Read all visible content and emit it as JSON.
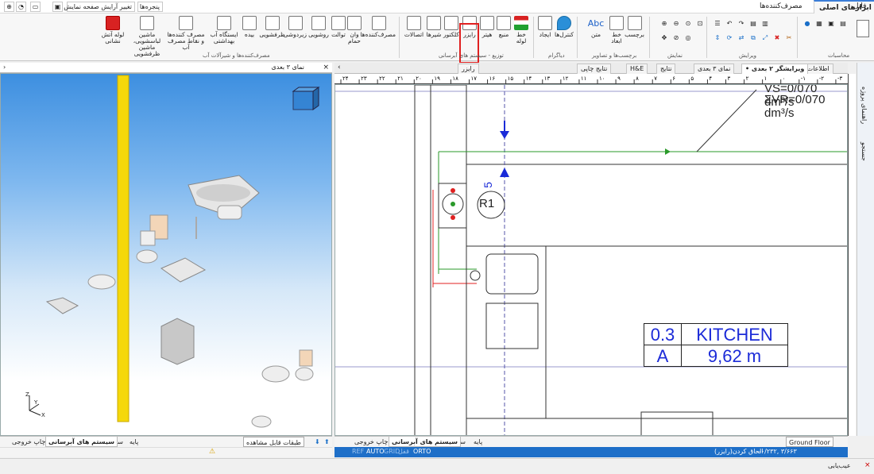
{
  "menubar": {
    "tabs": [
      "فایل",
      "ابزارهای اصلی",
      "مصرف‌کننده‌ها"
    ],
    "windows": "پنجره‌ها",
    "change_layout": "تغییر آرایش صفحه نمایش"
  },
  "ribbon": {
    "buttons": [
      "لوله آتش نشانی",
      "ماشین لباسشویی، ماشین ظرفشویی",
      "مصرف کننده‌ها و نقاط مصرف آب",
      "ایستگاه آب بهداشتی",
      "بیده",
      "ظرفشویی",
      "زیردوشی",
      "روشویی",
      "توالت",
      "وان حمام",
      "مصرف‌کننده‌ها",
      "اتصالات",
      "شیرها",
      "کلکتور",
      "رایزر",
      "هیتر",
      "منبع",
      "خط لوله",
      "کنترل‌ها",
      "ایجاد",
      "متن",
      "خط ابعاد",
      "برچسب"
    ],
    "groups": [
      "مصرف‌کننده‌ها و شیرآلات آب",
      "توزیع - سیستم های آبرسانی",
      "دیاگرام",
      "برچسب‌ها و تصاویر",
      "نمایش",
      "ویرایش",
      "محاسبات"
    ],
    "abc": "Abc"
  },
  "left_view": {
    "title": "نمای ۳ بعدی",
    "axes": [
      "Z",
      "Y",
      "X"
    ]
  },
  "doc_tabs": [
    "اطلاعات کلی",
    "ویرایشگر ۲ بعدی •",
    "نمای ۳ بعدی",
    "نتایج",
    "H&E",
    "نتایج چاپی",
    "رایزر"
  ],
  "drawing": {
    "vs": "VS=0/070 dm³/s",
    "svr": "ΣVR=0/070 dm³/s",
    "riser": "R1",
    "num5": "5",
    "room": {
      "r1c1": "0.3",
      "r1c2": "KITCHEN",
      "r2c1": "A",
      "r2c2": "9,62 m"
    }
  },
  "ruler_labels": [
    "۲۴",
    "۲۳",
    "۲۲",
    "۲۱",
    "۲۰",
    "۱۹",
    "۱۸",
    "۱۷",
    "۱۶",
    "۱۵",
    "۱۴",
    "۱۳",
    "۱۲",
    "۱۱",
    "۱۰",
    "۹",
    "۸",
    "۷",
    "۶",
    "۵",
    "۴",
    "۳",
    "۲",
    "۱",
    "۰",
    "-۱",
    "-۲",
    "-۳"
  ],
  "bottom_left": {
    "tabs": [
      "پایه",
      "ساخت",
      "سیستم های آبرسانی",
      "چاپ خروجی"
    ],
    "layers": "طبقات قابل مشاهده"
  },
  "bottom_right": {
    "tabs": [
      "پایه",
      "ساخت",
      "سیستم های آبرسانی",
      "چاپ خروجی"
    ],
    "floor": "Ground Floor"
  },
  "status": {
    "modes": [
      "REF",
      "AUTO",
      "GRID",
      "ORTO"
    ],
    "hint": "الحاق کردن(رایزر)",
    "coords": "-۰/۲۳۲, ۳/۶۶۳",
    "mode_extra": "قفل"
  },
  "side": {
    "tabs": [
      "راهنمای پروژه",
      "جستجو"
    ]
  },
  "footer": {
    "label": "عیب‌یابی"
  }
}
